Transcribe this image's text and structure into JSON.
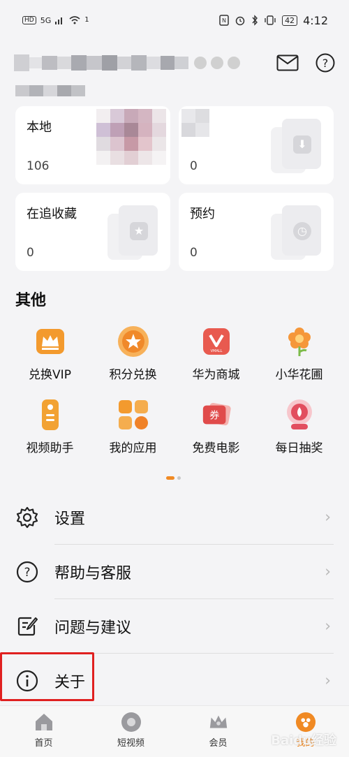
{
  "status_bar": {
    "left_badges": [
      "HD",
      "5G"
    ],
    "notification_count": "1",
    "battery": "42",
    "time": "4:12"
  },
  "header": {
    "mail_icon": "mail-icon",
    "help_icon": "help-icon"
  },
  "cards": [
    {
      "title": "本地",
      "count": "106",
      "icon": "phone-icon"
    },
    {
      "title": "",
      "count": "0",
      "icon": "download-icon"
    },
    {
      "title": "在追收藏",
      "count": "0",
      "icon": "star-icon"
    },
    {
      "title": "预约",
      "count": "0",
      "icon": "clock-icon"
    }
  ],
  "other": {
    "title": "其他",
    "apps": [
      {
        "label": "兑换VIP",
        "icon": "vip-crown-icon",
        "color": "#f39a2e"
      },
      {
        "label": "积分兑换",
        "icon": "points-star-icon",
        "color": "#f0892a"
      },
      {
        "label": "华为商城",
        "icon": "vmall-icon",
        "color": "#e85a4f"
      },
      {
        "label": "小华花圃",
        "icon": "flower-icon",
        "color": "#f5973a"
      },
      {
        "label": "视频助手",
        "icon": "remote-icon",
        "color": "#f2a233"
      },
      {
        "label": "我的应用",
        "icon": "apps-grid-icon",
        "color": "#f39a2e"
      },
      {
        "label": "免费电影",
        "icon": "ticket-icon",
        "color": "#e04b4b"
      },
      {
        "label": "每日抽奖",
        "icon": "lottery-icon",
        "color": "#e24e5f"
      }
    ]
  },
  "settings_list": [
    {
      "label": "设置",
      "icon": "gear-icon"
    },
    {
      "label": "帮助与客服",
      "icon": "question-circle-icon"
    },
    {
      "label": "问题与建议",
      "icon": "feedback-edit-icon"
    },
    {
      "label": "关于",
      "icon": "info-circle-icon"
    }
  ],
  "bottom_nav": [
    {
      "label": "首页",
      "icon": "home-icon",
      "active": false
    },
    {
      "label": "短视频",
      "icon": "short-video-icon",
      "active": false
    },
    {
      "label": "会员",
      "icon": "crown-icon",
      "active": false
    },
    {
      "label": "我的",
      "icon": "profile-icon",
      "active": true
    }
  ],
  "colors": {
    "accent": "#f08a24",
    "highlight_box": "#e02020",
    "background": "#f4f4f6"
  },
  "watermark": "Baidu经验"
}
